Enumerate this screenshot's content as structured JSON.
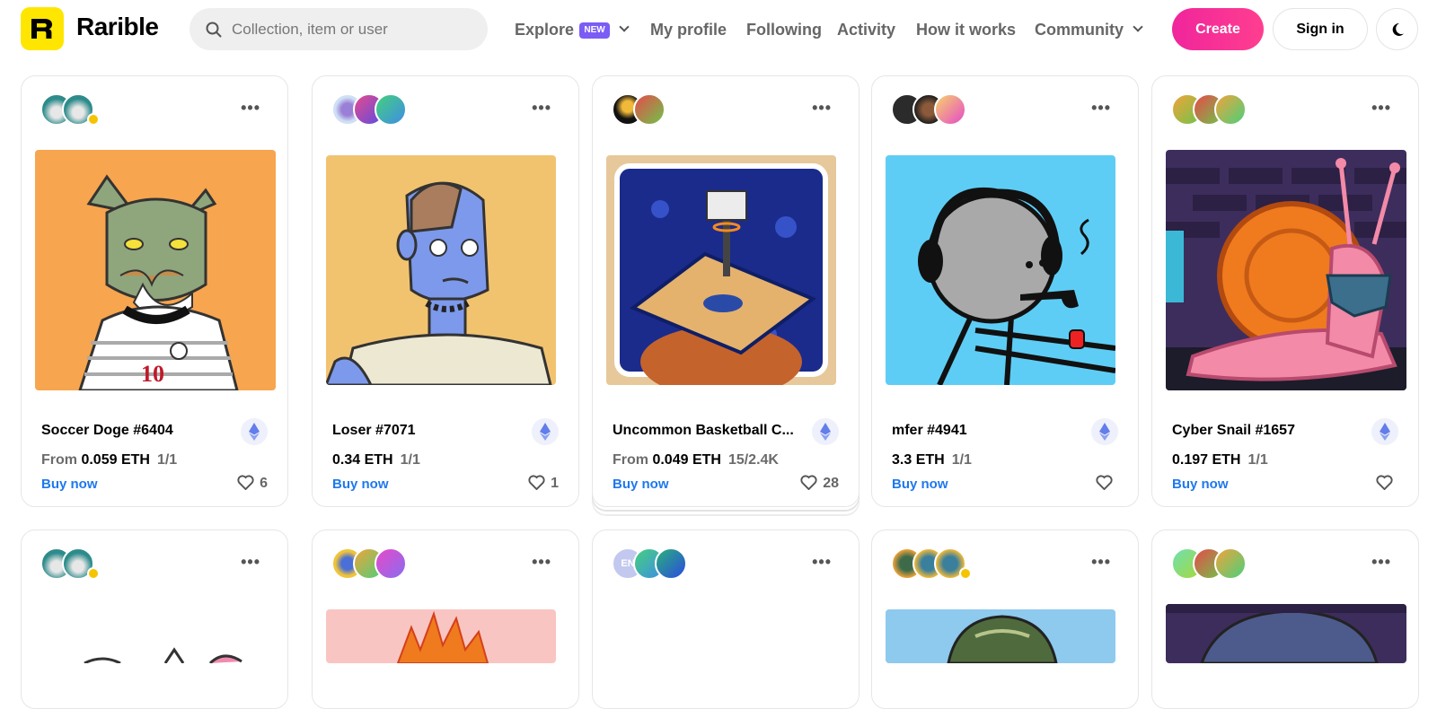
{
  "header": {
    "brand": "Rarible",
    "search_placeholder": "Collection, item or user",
    "nav": {
      "explore": "Explore",
      "new_badge": "NEW",
      "my_profile": "My profile",
      "following": "Following",
      "activity": "Activity",
      "how_it_works": "How it works",
      "community": "Community"
    },
    "create": "Create",
    "sign_in": "Sign in"
  },
  "cards": [
    {
      "title": "Soccer Doge #6404",
      "price_prefix": "From",
      "price": "0.059 ETH",
      "edition": "1/1",
      "buy": "Buy now",
      "likes": "6"
    },
    {
      "title": "Loser #7071",
      "price_prefix": "",
      "price": "0.34 ETH",
      "edition": "1/1",
      "buy": "Buy now",
      "likes": "1"
    },
    {
      "title": "Uncommon Basketball C...",
      "price_prefix": "From",
      "price": "0.049 ETH",
      "edition": "15/2.4K",
      "buy": "Buy now",
      "likes": "28"
    },
    {
      "title": "mfer #4941",
      "price_prefix": "",
      "price": "3.3 ETH",
      "edition": "1/1",
      "buy": "Buy now",
      "likes": ""
    },
    {
      "title": "Cyber Snail #1657",
      "price_prefix": "",
      "price": "0.197 ETH",
      "edition": "1/1",
      "buy": "Buy now",
      "likes": ""
    }
  ],
  "row2_avatar_label": "EN",
  "colors": {
    "accent_create": "#f0259c",
    "link_blue": "#1e78ee",
    "logo_yellow": "#fee600",
    "new_badge": "#7b5cf5"
  }
}
